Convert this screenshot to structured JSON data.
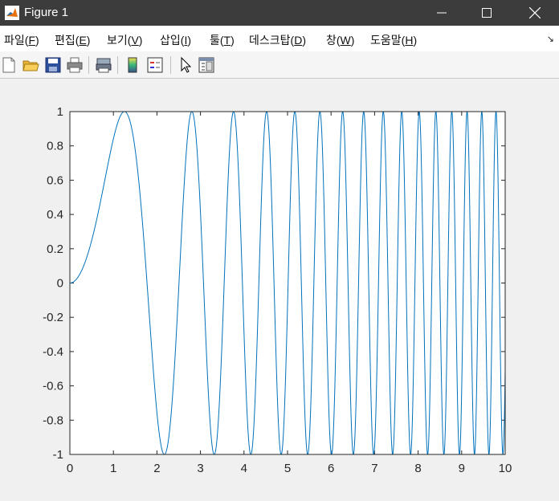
{
  "window": {
    "title": "Figure 1"
  },
  "menu": [
    {
      "label": "파일(",
      "key": "F",
      "end": ")"
    },
    {
      "label": "편집(",
      "key": "E",
      "end": ")"
    },
    {
      "label": "보기(",
      "key": "V",
      "end": ")"
    },
    {
      "label": "삽입(",
      "key": "I",
      "end": ")"
    },
    {
      "label": "툴(",
      "key": "T",
      "end": ")"
    },
    {
      "label": "데스크탑(",
      "key": "D",
      "end": ")"
    },
    {
      "label": "창(",
      "key": "W",
      "end": ")"
    },
    {
      "label": "도움말(",
      "key": "H",
      "end": ")"
    }
  ],
  "toolbar": [
    "new-figure-icon",
    "open-file-icon",
    "save-icon",
    "print-icon",
    "print-preview-icon",
    "colorbar-icon",
    "legend-icon",
    "pointer-icon",
    "property-editor-icon"
  ],
  "colors": {
    "line": "#0072bd",
    "titlebar": "#3c3c3c",
    "background": "#f0f0f0"
  },
  "chart_data": {
    "type": "line",
    "title": "",
    "xlabel": "",
    "ylabel": "",
    "function": "y = sin(x^2)",
    "xlim": [
      0,
      10
    ],
    "ylim": [
      -1,
      1
    ],
    "xticks": [
      "0",
      "1",
      "2",
      "3",
      "4",
      "5",
      "6",
      "7",
      "8",
      "9",
      "10"
    ],
    "yticks": [
      "1",
      "0.8",
      "0.6",
      "0.4",
      "0.2",
      "0",
      "-0.2",
      "-0.4",
      "-0.6",
      "-0.8",
      "-1"
    ],
    "grid": false,
    "series": [
      {
        "x_range": [
          0,
          10
        ],
        "y_end": -0.506
      }
    ]
  }
}
